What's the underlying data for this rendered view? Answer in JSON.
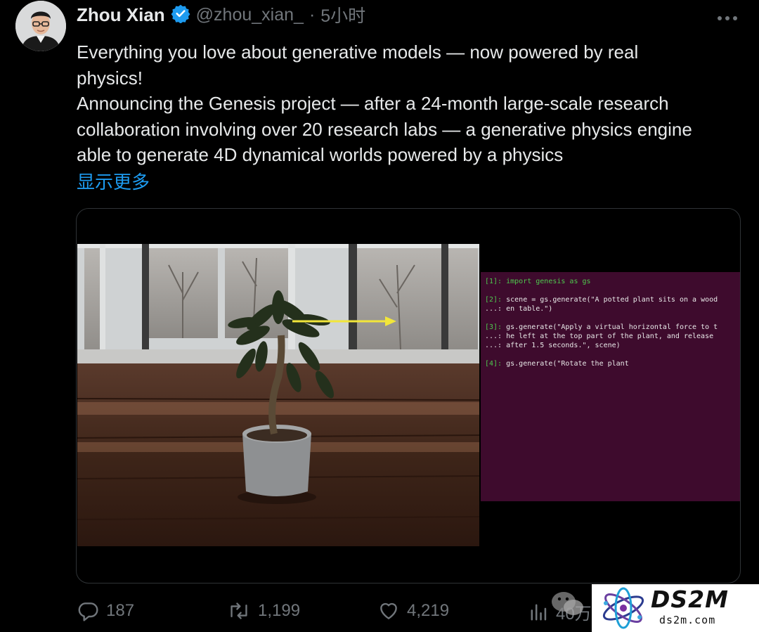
{
  "author": {
    "name": "Zhou Xian",
    "handle": "@zhou_xian_",
    "separator": "·",
    "time": "5小时",
    "verified_color": "#1d9bf0"
  },
  "tweet": {
    "lines": [
      "Everything you love about generative models — now powered by real",
      "physics!",
      "Announcing the Genesis project — after a 24-month large-scale research",
      "collaboration involving over 20 research labs — a generative physics engine",
      "able to generate 4D dynamical worlds powered by a physics"
    ],
    "show_more": "显示更多"
  },
  "terminal": {
    "blocks": [
      {
        "prompt": "[1]:",
        "lines": [
          "import genesis as gs"
        ]
      },
      {
        "prompt": "[2]:",
        "lines": [
          "scene = gs.generate(\"A potted plant sits on a wood",
          "...: en table.\")"
        ]
      },
      {
        "prompt": "[3]:",
        "lines": [
          "gs.generate(\"Apply a virtual horizontal force to t",
          "...: he left at the top part of the plant, and release",
          "...: after 1.5 seconds.\", scene)"
        ]
      },
      {
        "prompt": "[4]:",
        "lines": [
          "gs.generate(\"Rotate the plant"
        ]
      }
    ]
  },
  "actions": {
    "replies": "187",
    "retweets": "1,199",
    "likes": "4,219",
    "views": "40万"
  },
  "watermark": {
    "title": "DS2M",
    "url": "ds2m.com"
  }
}
